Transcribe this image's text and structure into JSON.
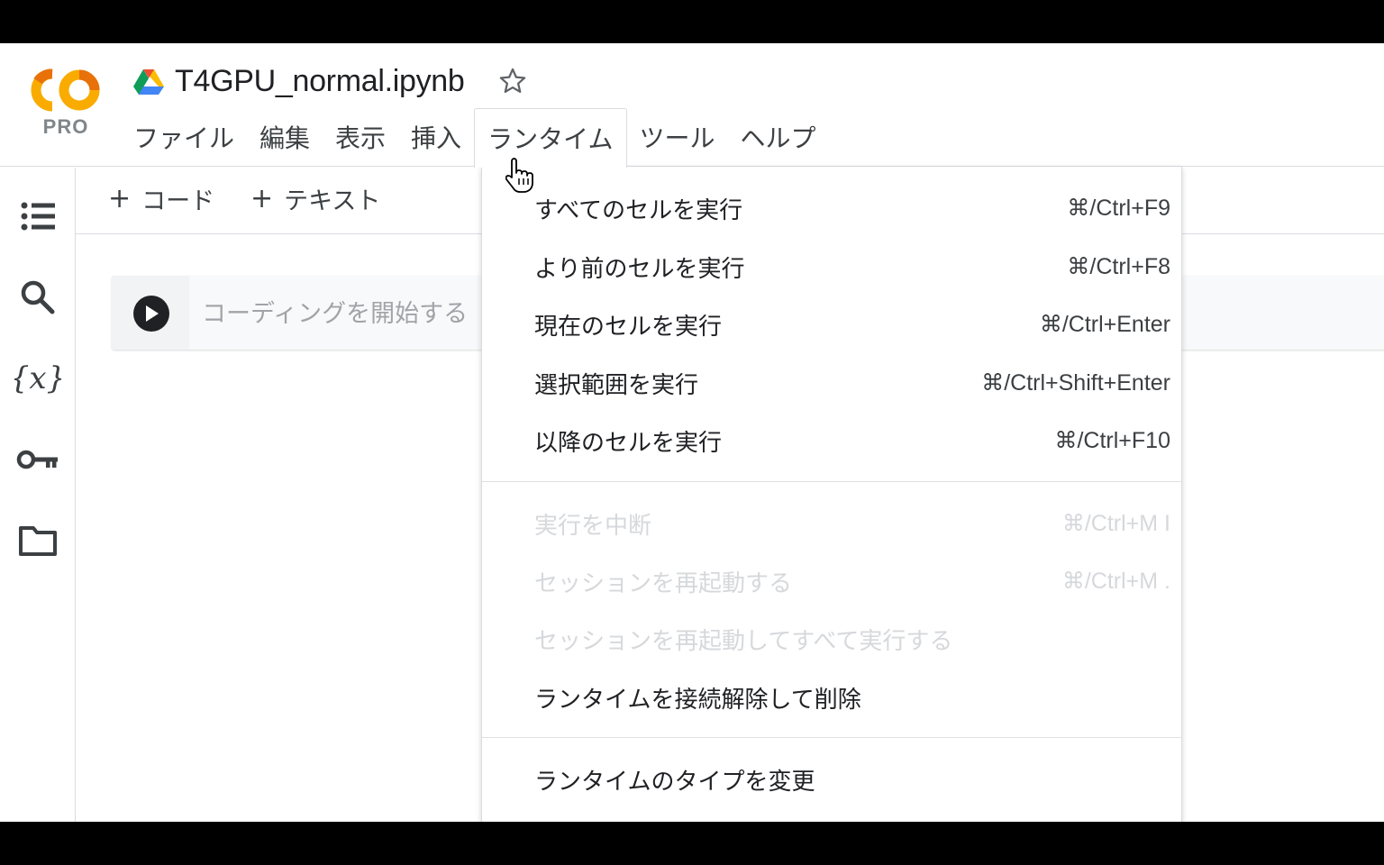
{
  "app": {
    "logo_text": "CO",
    "logo_badge": "PRO",
    "title": "T4GPU_normal.ipynb"
  },
  "menubar": {
    "items": [
      "ファイル",
      "編集",
      "表示",
      "挿入",
      "ランタイム",
      "ツール",
      "ヘルプ"
    ],
    "active": "ランタイム"
  },
  "toolbar": {
    "add_code": "コード",
    "add_text": "テキスト"
  },
  "sidebar": {
    "icons": [
      "table-of-contents-icon",
      "search-icon",
      "variables-icon",
      "key-icon",
      "folder-icon"
    ]
  },
  "cell": {
    "placeholder": "コーディングを開始する"
  },
  "runtime_menu": {
    "items": [
      {
        "label": "すべてのセルを実行",
        "shortcut": "⌘/Ctrl+F9",
        "disabled": false
      },
      {
        "label": "より前のセルを実行",
        "shortcut": "⌘/Ctrl+F8",
        "disabled": false
      },
      {
        "label": "現在のセルを実行",
        "shortcut": "⌘/Ctrl+Enter",
        "disabled": false
      },
      {
        "label": "選択範囲を実行",
        "shortcut": "⌘/Ctrl+Shift+Enter",
        "disabled": false
      },
      {
        "label": "以降のセルを実行",
        "shortcut": "⌘/Ctrl+F10",
        "disabled": false
      },
      {
        "label": "実行を中断",
        "shortcut": "⌘/Ctrl+M I",
        "disabled": true
      },
      {
        "label": "セッションを再起動する",
        "shortcut": "⌘/Ctrl+M .",
        "disabled": true
      },
      {
        "label": "セッションを再起動してすべて実行する",
        "shortcut": "",
        "disabled": true
      },
      {
        "label": "ランタイムを接続解除して削除",
        "shortcut": "",
        "disabled": false
      },
      {
        "label": "ランタイムのタイプを変更",
        "shortcut": "",
        "disabled": false
      }
    ]
  },
  "colors": {
    "logo_orange": "#F9AB00",
    "logo_dark_orange": "#E8710A",
    "text_primary": "#202124",
    "disabled_text": "#D6D8DB",
    "divider": "#DADCE0"
  }
}
